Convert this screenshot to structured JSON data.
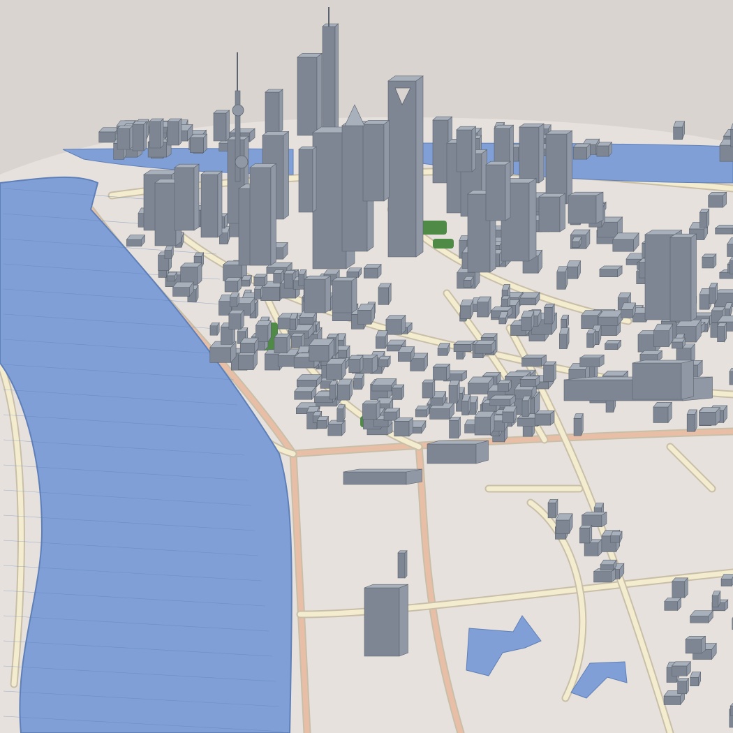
{
  "scene": {
    "subject": "3d-city-model",
    "style": "untextured-grey-massing-model",
    "colors": {
      "sky": "#d9d4d0",
      "ground": "#e6e1dc",
      "road_fill": "#f4eccf",
      "road_edge": "#c9bfa9",
      "arterial": "#e8bfa6",
      "water": "#7f9fd6",
      "water_edge": "#5f7fb8",
      "park": "#4f8a47",
      "building_top": "#a7b0bb",
      "building_left": "#7d8692",
      "building_right": "#8f98a4",
      "building_outline": "#5b636e"
    }
  }
}
